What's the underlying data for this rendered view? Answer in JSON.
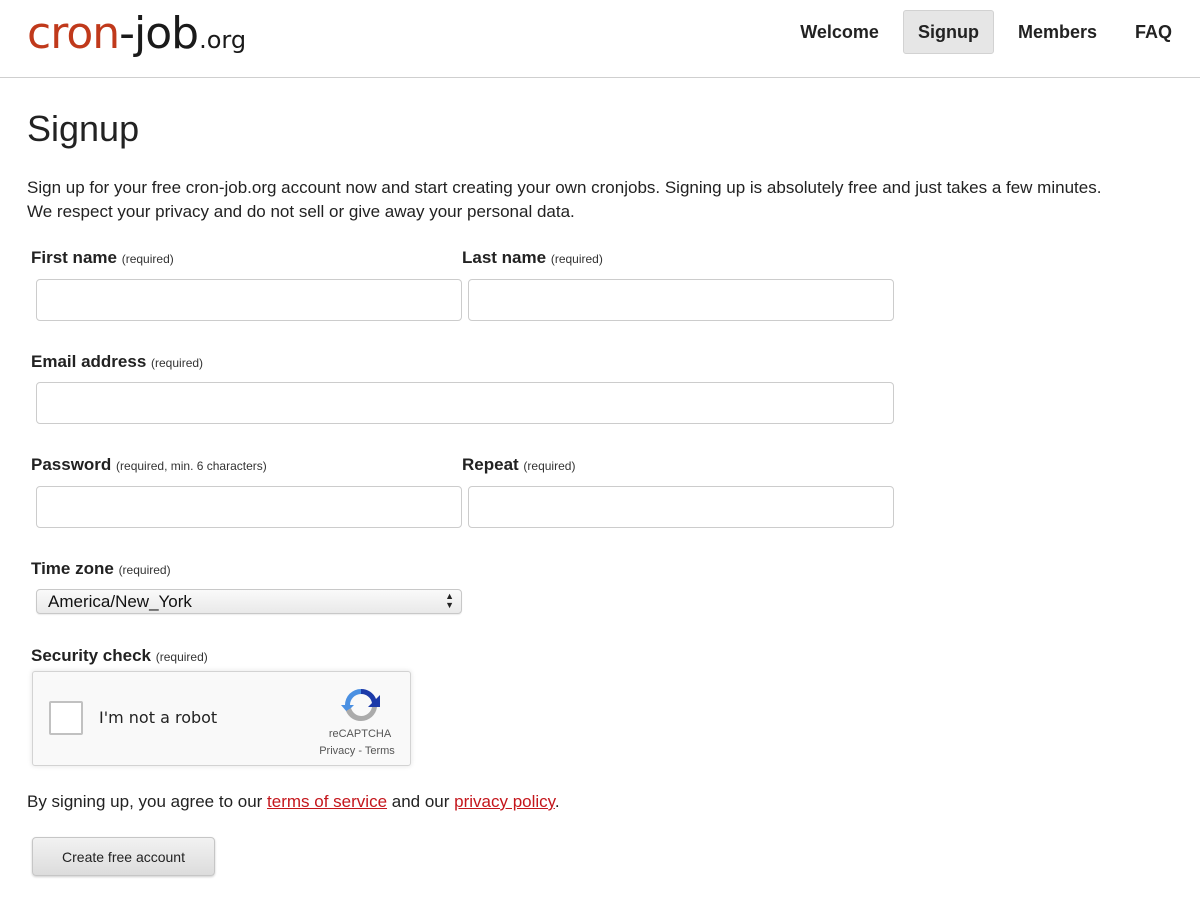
{
  "header": {
    "logo": {
      "part1": "cr",
      "clock_o": "o",
      "part2": "n",
      "part3": "-job",
      "tld": ".org"
    },
    "nav": [
      {
        "label": "Welcome",
        "active": false
      },
      {
        "label": "Signup",
        "active": true
      },
      {
        "label": "Members",
        "active": false
      },
      {
        "label": "FAQ",
        "active": false
      }
    ]
  },
  "page": {
    "title": "Signup",
    "intro_line1": "Sign up for your free cron-job.org account now and start creating your own cronjobs. Signing up is absolutely free and just takes a few minutes.",
    "intro_line2": "We respect your privacy and do not sell or give away your personal data."
  },
  "form": {
    "first_name": {
      "label": "First name",
      "hint": "(required)",
      "value": ""
    },
    "last_name": {
      "label": "Last name",
      "hint": "(required)",
      "value": ""
    },
    "email": {
      "label": "Email address",
      "hint": "(required)",
      "value": ""
    },
    "password": {
      "label": "Password",
      "hint": "(required, min. 6 characters)",
      "value": ""
    },
    "repeat": {
      "label": "Repeat",
      "hint": "(required)",
      "value": ""
    },
    "timezone": {
      "label": "Time zone",
      "hint": "(required)",
      "selected": "America/New_York"
    },
    "security": {
      "label": "Security check",
      "hint": "(required)"
    },
    "captcha": {
      "checkbox_label": "I'm not a robot",
      "brand": "reCAPTCHA",
      "privacy": "Privacy",
      "separator": " - ",
      "terms": "Terms"
    },
    "agreement": {
      "prefix": "By signing up, you agree to our ",
      "tos_link": "terms of service",
      "middle": " and our ",
      "privacy_link": "privacy policy",
      "suffix": "."
    },
    "submit_label": "Create free account"
  },
  "colors": {
    "brand_red": "#c0391b",
    "link_red": "#c4161c"
  }
}
